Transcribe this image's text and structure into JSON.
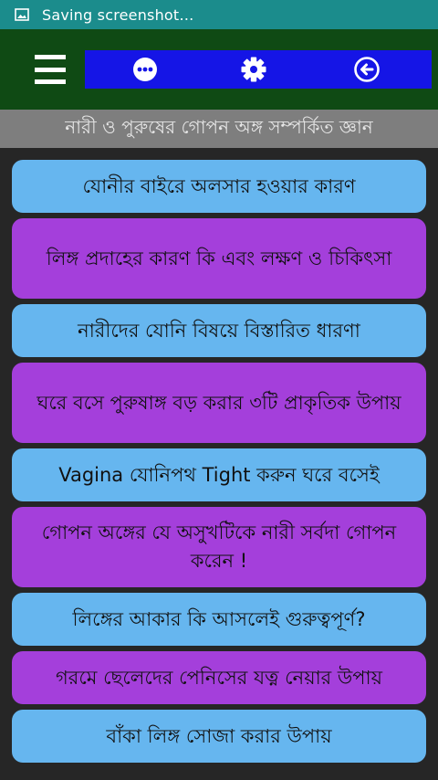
{
  "status_bar": {
    "text": "Saving screenshot…",
    "icon": "gallery-icon"
  },
  "app_bar": {
    "menu_icon": "hamburger-menu-icon",
    "actions": [
      "more-icon",
      "settings-gear-icon",
      "back-arrow-icon"
    ],
    "colors": {
      "app_bar": "#0f4a14",
      "toolbar": "#1515e6",
      "status_bar": "#1b8c8c"
    }
  },
  "header": {
    "title": "নারী ও পুরুষের গোপন অঙ্গ সম্পর্কিত জ্ঞান"
  },
  "items": [
    {
      "label": "যোনীর বাইরে অলসার হওয়ার কারণ",
      "color": "blue"
    },
    {
      "label": "লিঙ্গ প্রদাহের কারণ কি এবং লক্ষণ ও চিকিৎসা",
      "color": "purple"
    },
    {
      "label": "নারীদের যোনি বিষয়ে বিস্তারিত ধারণা",
      "color": "blue"
    },
    {
      "label": "ঘরে বসে পুরুষাঙ্গ বড় করার ৩টি প্রাকৃতিক উপায়",
      "color": "purple"
    },
    {
      "label": "Vagina যোনিপথ Tight করুন ঘরে বসেই",
      "color": "blue"
    },
    {
      "label": "গোপন অঙ্গের যে অসুখটিকে নারী সর্বদা গোপন করেন !",
      "color": "purple"
    },
    {
      "label": "লিঙ্গের আকার কি আসলেই গুরুত্বপূর্ণ?",
      "color": "blue"
    },
    {
      "label": "গরমে ছেলেদের পেনিসের যত্ন নেয়ার উপায়",
      "color": "purple"
    },
    {
      "label": "বাঁকা লিঙ্গ সোজা করার উপায়",
      "color": "blue"
    }
  ]
}
